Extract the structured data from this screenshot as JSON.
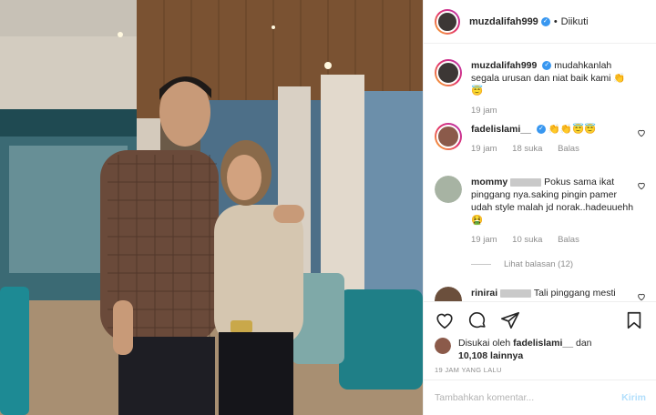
{
  "header": {
    "username": "muzdalifah999",
    "follow_status": "Diikuti",
    "dot": "•"
  },
  "caption": {
    "username": "muzdalifah999",
    "text": "mudahkanlah segala urusan dan niat baik kami 👏😇",
    "time": "19 jam"
  },
  "comments": [
    {
      "username": "fadelislami__",
      "text": "👏👏😇😇",
      "time": "19 jam",
      "likes": "18 suka",
      "reply": "Balas"
    },
    {
      "username": "mommy",
      "text": "Pokus sama ikat pinggang nya.saking pingin pamer udah style malah jd norak..hadeuuehh🤮",
      "time": "19 jam",
      "likes": "10 suka",
      "reply": "Balas"
    },
    {
      "username": "rinirai",
      "text": "Tali pinggang mesti"
    }
  ],
  "view_replies": "Lihat balasan (12)",
  "likes": {
    "prefix": "Disukai oleh",
    "user": "fadelislami__",
    "and": "dan",
    "count": "10,108 lainnya"
  },
  "timestamp": "19 JAM YANG LALU",
  "composer": {
    "placeholder": "Tambahkan komentar...",
    "send": "Kirim"
  },
  "icons": [
    "heart-icon",
    "comment-icon",
    "share-icon",
    "bookmark-icon",
    "verified-icon"
  ],
  "colors": {
    "verified": "#3897f0",
    "send_disabled": "#b2dffc",
    "meta_text": "#8e8e8e"
  }
}
